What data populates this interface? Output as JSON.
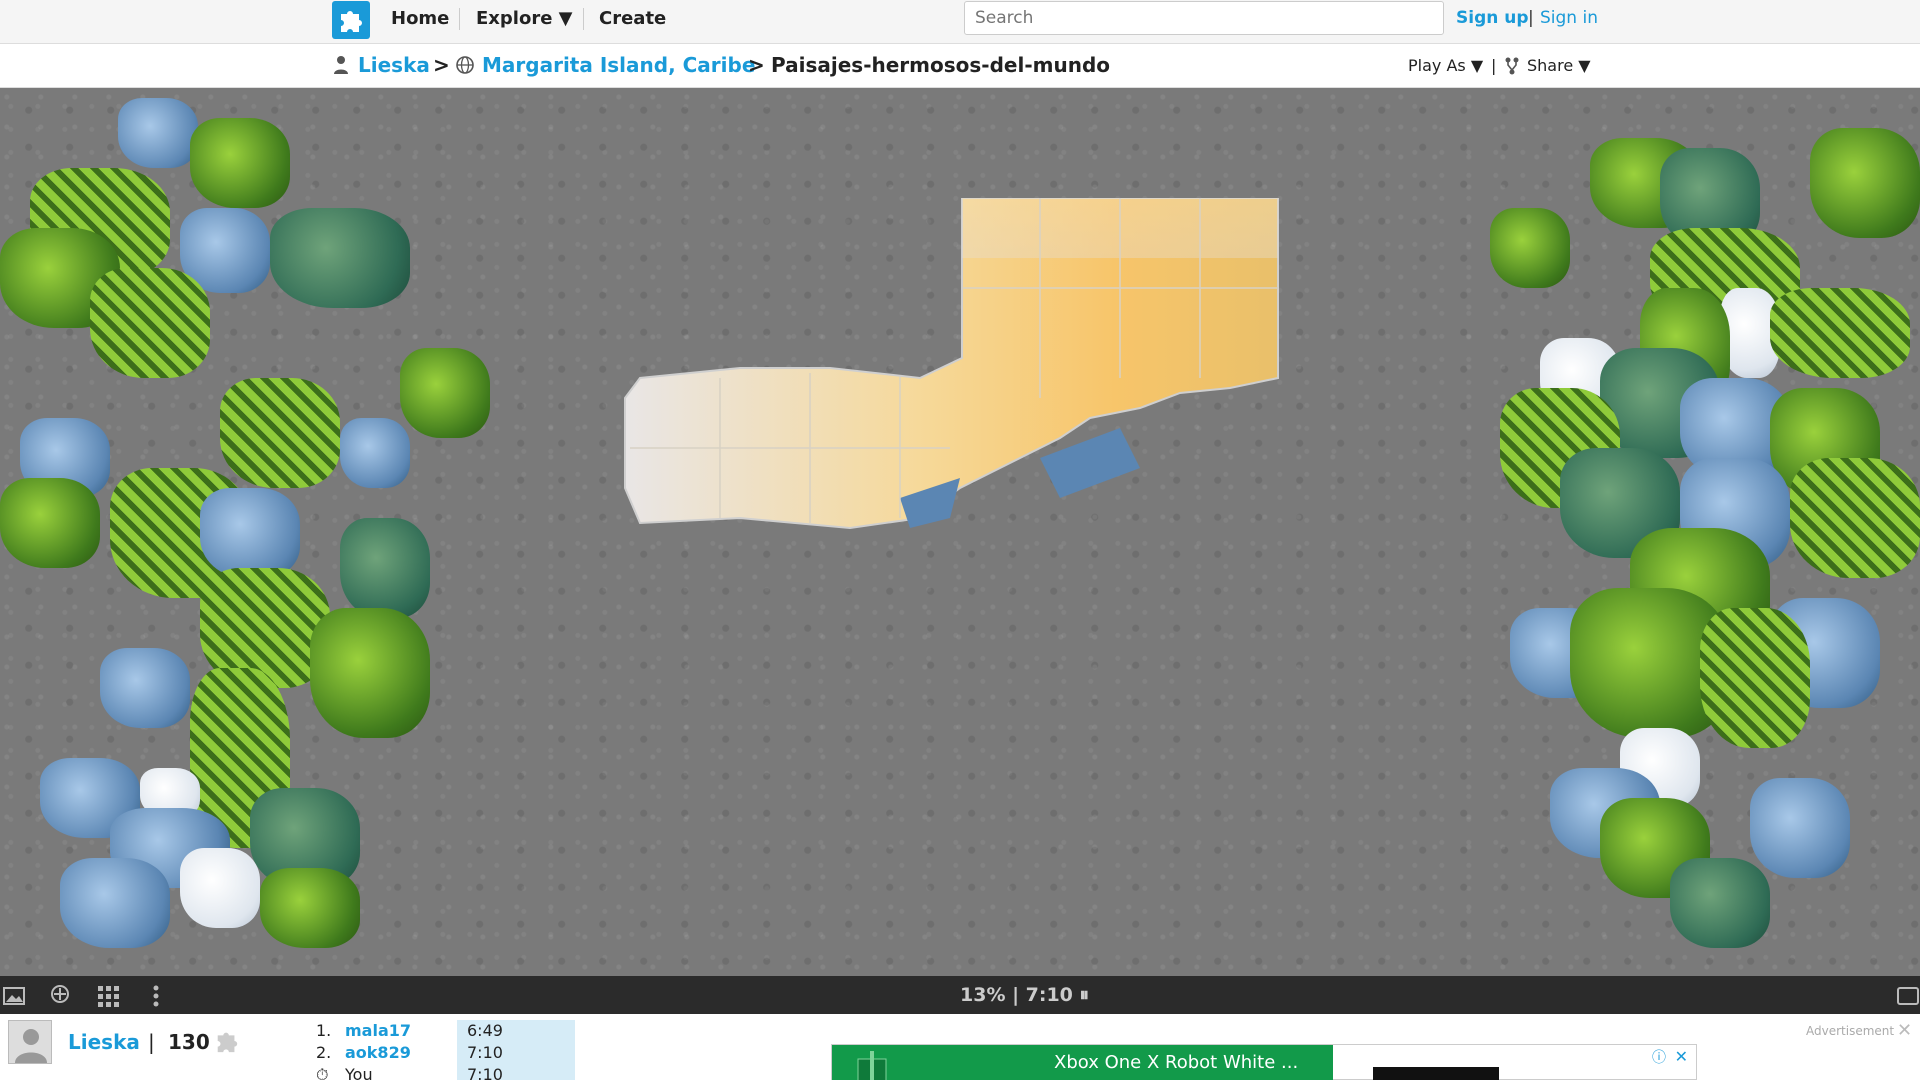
{
  "topbar": {
    "nav": [
      "Home",
      "Explore ▼",
      "Create"
    ],
    "search_placeholder": "Search",
    "signup": "Sign up",
    "signin": "Sign in",
    "pipe": "|"
  },
  "breadcrumb": {
    "user": "Lieska",
    "sep": ">",
    "collection": "Margarita Island, Caribe",
    "puzzle": "Paisajes-hermosos-del-mundo",
    "play_as": "Play As ▼",
    "divider": "|",
    "share": "Share ▼"
  },
  "toolbar": {
    "status": "13% | 7:10 ⏸",
    "progress_percent": 13,
    "timer": "7:10"
  },
  "player": {
    "name": "Lieska",
    "divider": "|",
    "score": "130"
  },
  "leaderboard": [
    {
      "rank": "1.",
      "name": "mala17",
      "time": "6:49"
    },
    {
      "rank": "2.",
      "name": "aok829",
      "time": "7:10"
    },
    {
      "rank": "⏱",
      "name": "You",
      "time": "7:10"
    }
  ],
  "ad": {
    "label": "Advertisement",
    "title": "Xbox One X Robot White ...",
    "close": "✕",
    "info": "ⓘ"
  },
  "colors": {
    "accent": "#1a9ad8",
    "board": "#7a7a7a",
    "toolbar": "#2b2b2b",
    "ad_green": "#129a4a"
  }
}
